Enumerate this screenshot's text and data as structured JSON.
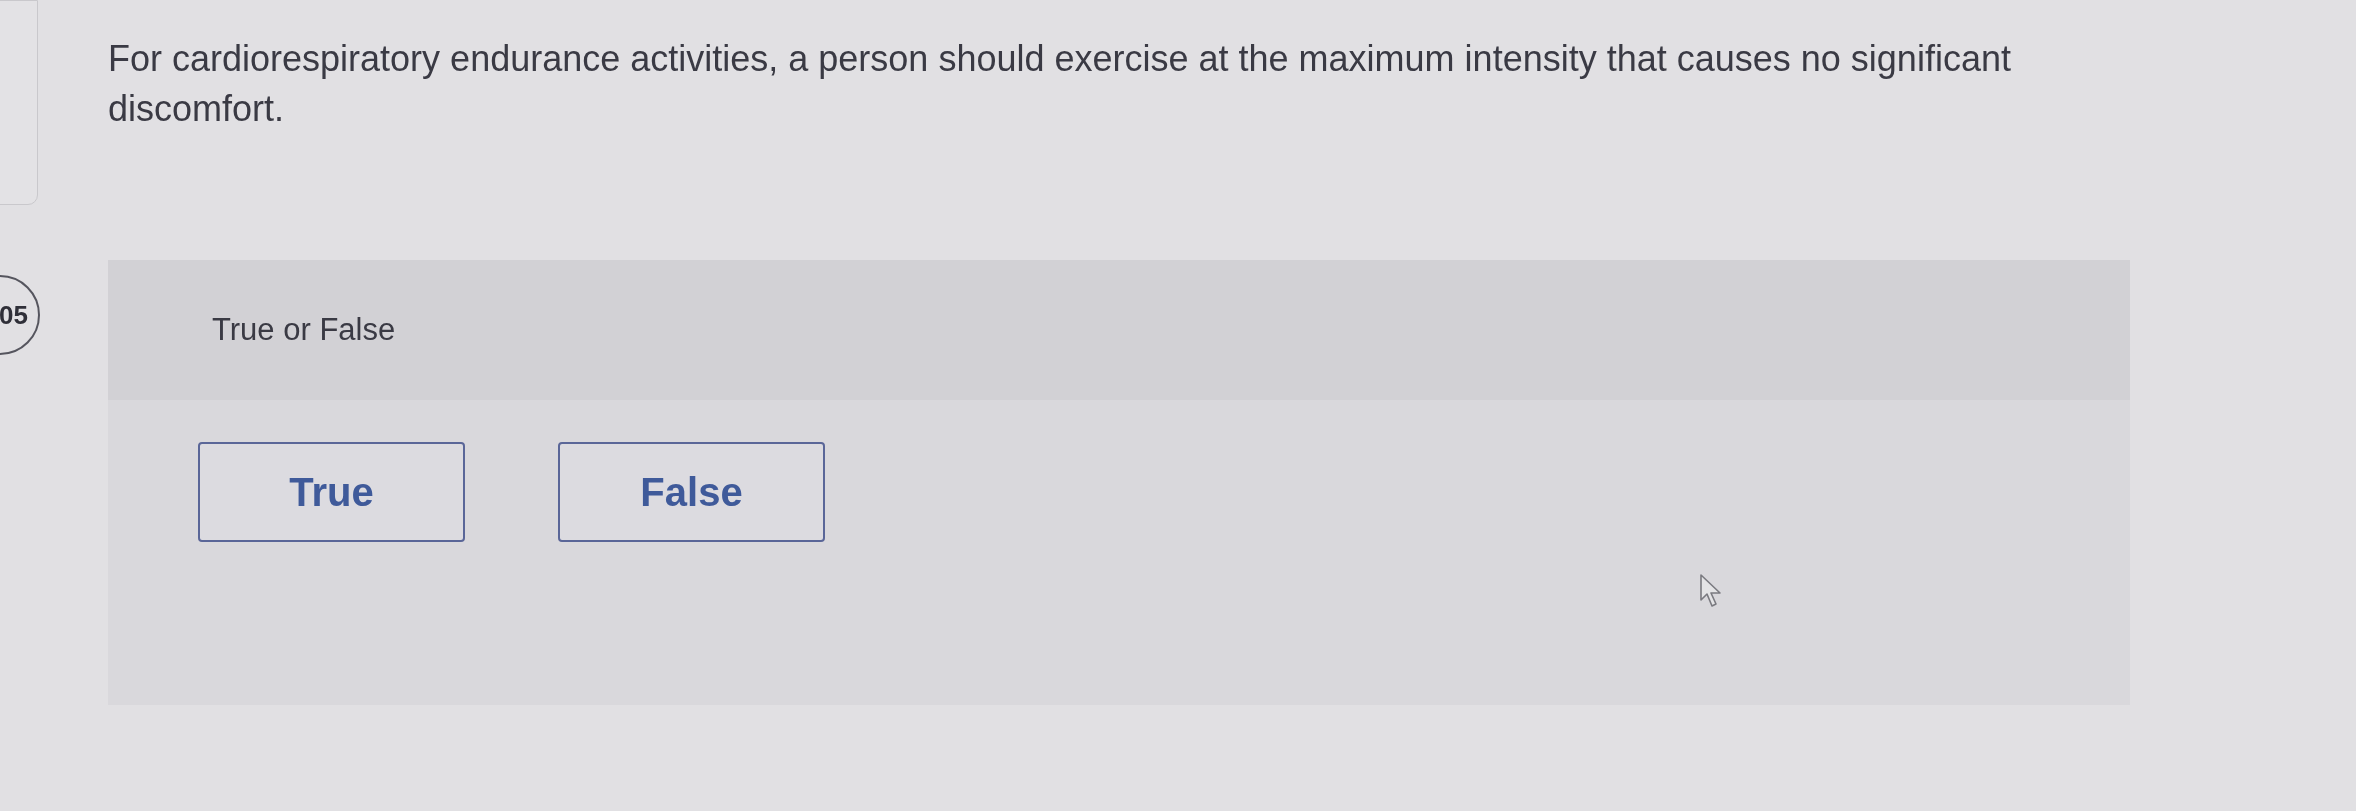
{
  "question": {
    "text": "For cardiorespiratory endurance activities, a person should exercise at the maximum intensity that causes no significant discomfort."
  },
  "question_number": "05",
  "answer_card": {
    "prompt": "True or False",
    "options": [
      {
        "label": "True",
        "selected": false
      },
      {
        "label": "False",
        "selected": false
      }
    ]
  }
}
